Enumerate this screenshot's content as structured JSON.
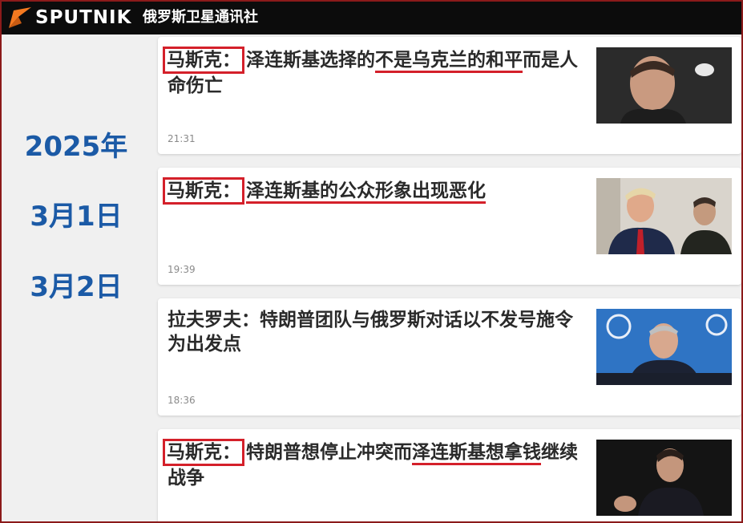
{
  "header": {
    "brand": "SPUTNIK",
    "brand_cn": "俄罗斯卫星通讯社"
  },
  "dates": {
    "year": "2025年",
    "day1": "3月1日",
    "day2": "3月2日"
  },
  "articles": [
    {
      "tag": "马斯克：",
      "title_a": "泽连斯基选择的",
      "title_u": "不是乌克兰的和平",
      "title_b": "而是人命伤亡",
      "time": "21:31",
      "image": "elon-musk-portrait"
    },
    {
      "tag": "马斯克：",
      "title_a": "",
      "title_u": "泽连斯基的公众形象出现恶化",
      "title_b": "",
      "time": "19:39",
      "image": "trump-zelensky-meeting"
    },
    {
      "tag": "",
      "title_a": "拉夫罗夫：特朗普团队与俄罗斯对话以不发号施令为出发点",
      "title_u": "",
      "title_b": "",
      "time": "18:36",
      "image": "lavrov-press-conference"
    },
    {
      "tag": "马斯克：",
      "title_a": "特朗普想停止冲突而",
      "title_u": "泽连斯基想拿钱",
      "title_b": "继续战争",
      "time": "",
      "image": "elon-musk-speaking"
    }
  ],
  "colors": {
    "accent_red": "#d4202a",
    "date_blue": "#1b5aa6",
    "header_bg": "#0c0c0c",
    "logo_orange": "#f47920"
  }
}
